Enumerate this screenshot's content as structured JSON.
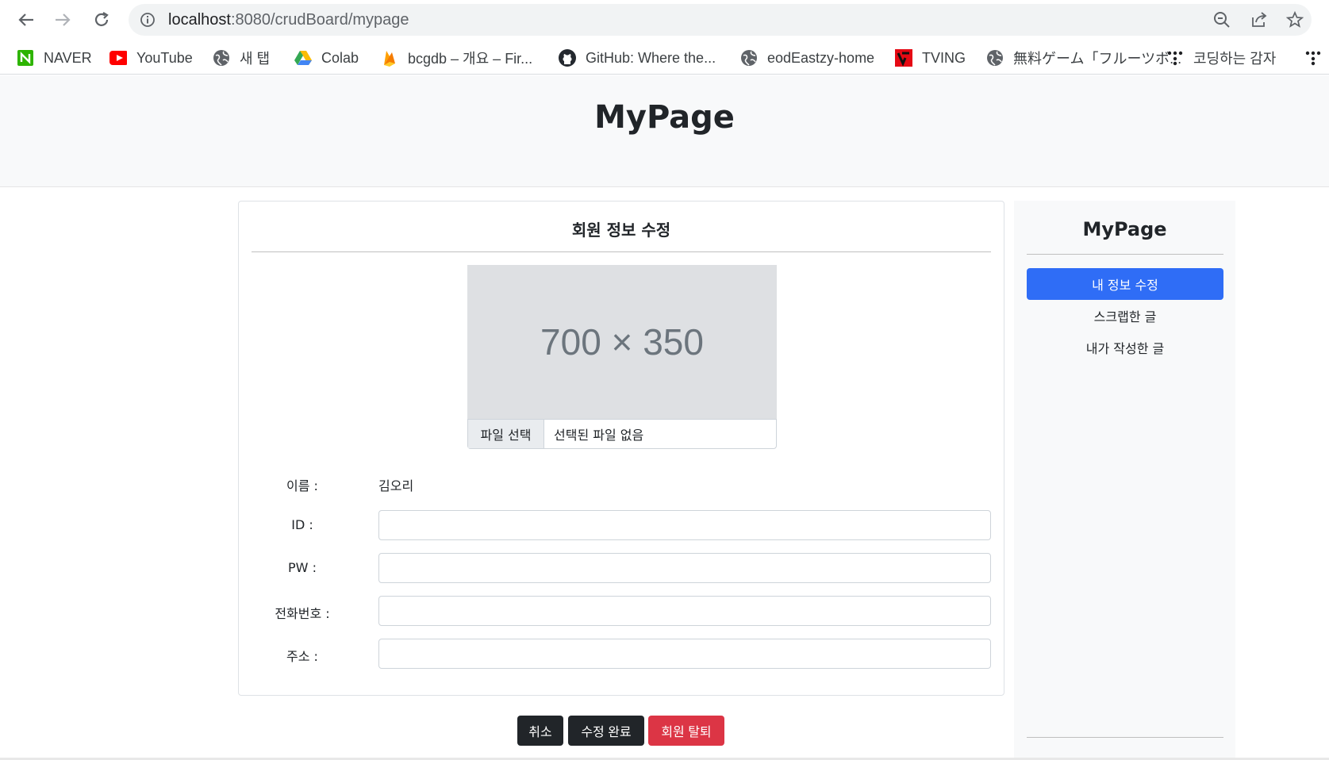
{
  "browser": {
    "url_host": "localhost",
    "url_path": ":8080/crudBoard/mypage",
    "bookmarks": [
      {
        "label": "NAVER",
        "icon": "naver-icon"
      },
      {
        "label": "YouTube",
        "icon": "youtube-icon"
      },
      {
        "label": "새 탭",
        "icon": "globe-icon"
      },
      {
        "label": "Colab",
        "icon": "google-drive-icon"
      },
      {
        "label": "bcgdb – 개요 – Fir...",
        "icon": "firebase-icon"
      },
      {
        "label": "GitHub: Where the...",
        "icon": "github-icon"
      },
      {
        "label": "eodEastzy-home",
        "icon": "globe-icon"
      },
      {
        "label": "TVING",
        "icon": "tving-icon"
      },
      {
        "label": "無料ゲーム「フルーツボ...",
        "icon": "globe-icon"
      },
      {
        "label": "코딩하는 감자",
        "icon": "dots-icon"
      }
    ]
  },
  "hero": {
    "title": "MyPage"
  },
  "form": {
    "title": "회원 정보 수정",
    "image_placeholder": "700 × 350",
    "file_button": "파일 선택",
    "file_status": "선택된 파일 없음",
    "name_label": "이름 :",
    "name_value": "김오리",
    "id_label": "ID :",
    "pw_label": "PW :",
    "phone_label": "전화번호 :",
    "address_label": "주소 :"
  },
  "actions": {
    "cancel": "취소",
    "submit": "수정 완료",
    "withdraw": "회원 탈퇴"
  },
  "sidebar": {
    "title": "MyPage",
    "items": [
      {
        "label": "내 정보 수정",
        "active": true
      },
      {
        "label": "스크랩한 글",
        "active": false
      },
      {
        "label": "내가 작성한 글",
        "active": false
      }
    ]
  },
  "colors": {
    "primary": "#2f6df6",
    "dark": "#212529",
    "danger": "#dc3545"
  }
}
